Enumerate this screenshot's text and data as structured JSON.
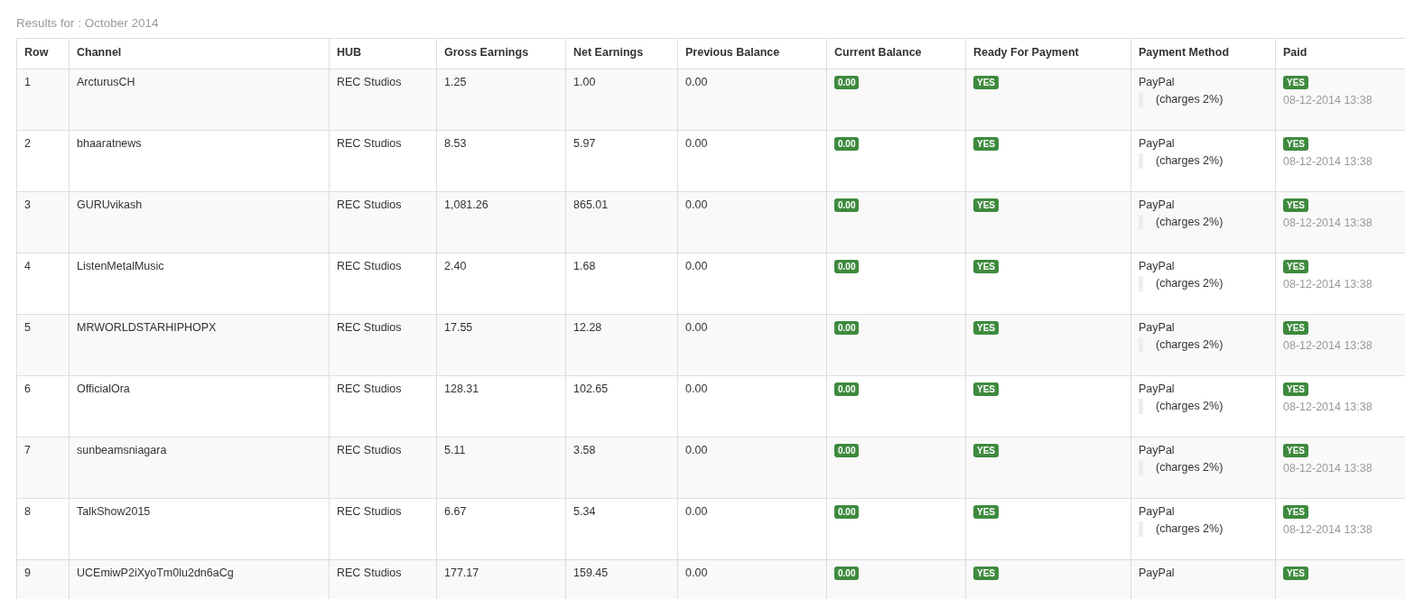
{
  "results_title": "Results for : October 2014",
  "table": {
    "columns": [
      "Row",
      "Channel",
      "HUB",
      "Gross Earnings",
      "Net Earnings",
      "Previous Balance",
      "Current Balance",
      "Ready For Payment",
      "Payment Method",
      "Paid"
    ],
    "rows": [
      {
        "row": "1",
        "channel": "ArcturusCH",
        "hub": "REC Studios",
        "gross": "1.25",
        "net": "1.00",
        "previous": "0.00",
        "current": "0.00",
        "ready": "YES",
        "method": "PayPal",
        "charges": "(charges 2%)",
        "paid": "YES",
        "paid_date": "08-12-2014 13:38"
      },
      {
        "row": "2",
        "channel": "bhaaratnews",
        "hub": "REC Studios",
        "gross": "8.53",
        "net": "5.97",
        "previous": "0.00",
        "current": "0.00",
        "ready": "YES",
        "method": "PayPal",
        "charges": "(charges 2%)",
        "paid": "YES",
        "paid_date": "08-12-2014 13:38"
      },
      {
        "row": "3",
        "channel": "GURUvikash",
        "hub": "REC Studios",
        "gross": "1,081.26",
        "net": "865.01",
        "previous": "0.00",
        "current": "0.00",
        "ready": "YES",
        "method": "PayPal",
        "charges": "(charges 2%)",
        "paid": "YES",
        "paid_date": "08-12-2014 13:38"
      },
      {
        "row": "4",
        "channel": "ListenMetalMusic",
        "hub": "REC Studios",
        "gross": "2.40",
        "net": "1.68",
        "previous": "0.00",
        "current": "0.00",
        "ready": "YES",
        "method": "PayPal",
        "charges": "(charges 2%)",
        "paid": "YES",
        "paid_date": "08-12-2014 13:38"
      },
      {
        "row": "5",
        "channel": "MRWORLDSTARHIPHOPX",
        "hub": "REC Studios",
        "gross": "17.55",
        "net": "12.28",
        "previous": "0.00",
        "current": "0.00",
        "ready": "YES",
        "method": "PayPal",
        "charges": "(charges 2%)",
        "paid": "YES",
        "paid_date": "08-12-2014 13:38"
      },
      {
        "row": "6",
        "channel": "OfficialOra",
        "hub": "REC Studios",
        "gross": "128.31",
        "net": "102.65",
        "previous": "0.00",
        "current": "0.00",
        "ready": "YES",
        "method": "PayPal",
        "charges": "(charges 2%)",
        "paid": "YES",
        "paid_date": "08-12-2014 13:38"
      },
      {
        "row": "7",
        "channel": "sunbeamsniagara",
        "hub": "REC Studios",
        "gross": "5.11",
        "net": "3.58",
        "previous": "0.00",
        "current": "0.00",
        "ready": "YES",
        "method": "PayPal",
        "charges": "(charges 2%)",
        "paid": "YES",
        "paid_date": "08-12-2014 13:38"
      },
      {
        "row": "8",
        "channel": "TalkShow2015",
        "hub": "REC Studios",
        "gross": "6.67",
        "net": "5.34",
        "previous": "0.00",
        "current": "0.00",
        "ready": "YES",
        "method": "PayPal",
        "charges": "(charges 2%)",
        "paid": "YES",
        "paid_date": "08-12-2014 13:38"
      },
      {
        "row": "9",
        "channel": "UCEmiwP2iXyoTm0lu2dn6aCg",
        "hub": "REC Studios",
        "gross": "177.17",
        "net": "159.45",
        "previous": "0.00",
        "current": "0.00",
        "ready": "YES",
        "method": "PayPal",
        "paid": "YES"
      }
    ]
  }
}
